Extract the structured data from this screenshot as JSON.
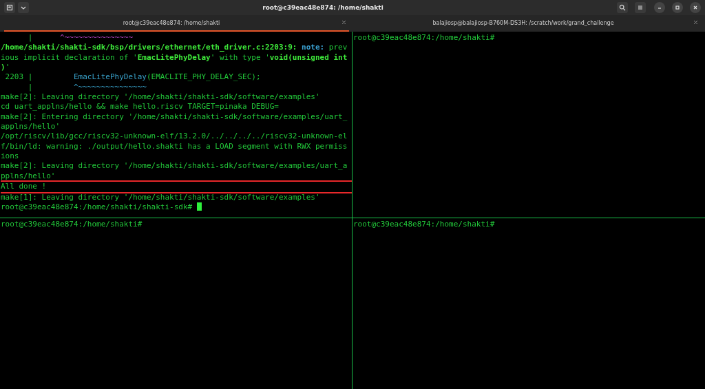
{
  "window": {
    "title": "root@c39eac48e874: /home/shakti"
  },
  "tabs": [
    {
      "label": "root@c39eac48e874: /home/shakti",
      "selected": true
    },
    {
      "label": "balajiosp@balajiosp-B760M-DS3H: /scratch/work/grand_challenge",
      "selected": false
    }
  ],
  "panes": [
    {
      "cursor": true,
      "lines": [
        {
          "highlighted": false,
          "segments": [
            {
              "text": "      |      ",
              "kind": "plain"
            },
            {
              "text": "^~~~~~~~~~~~~~~~",
              "kind": "caret"
            }
          ]
        },
        {
          "highlighted": false,
          "segments": [
            {
              "text": "/home/shakti/shakti-sdk/bsp/drivers/ethernet/eth_driver.c:2203:9: ",
              "kind": "bold"
            },
            {
              "text": "note:",
              "kind": "note"
            },
            {
              "text": " prev",
              "kind": "plain"
            }
          ]
        },
        {
          "highlighted": false,
          "segments": [
            {
              "text": "ious implicit declaration of '",
              "kind": "plain"
            },
            {
              "text": "EmacLitePhyDelay",
              "kind": "bold"
            },
            {
              "text": "' with type '",
              "kind": "plain"
            },
            {
              "text": "void(unsigned int",
              "kind": "bold"
            }
          ]
        },
        {
          "highlighted": false,
          "segments": [
            {
              "text": ")",
              "kind": "bold"
            },
            {
              "text": "'",
              "kind": "plain"
            }
          ]
        },
        {
          "highlighted": false,
          "segments": [
            {
              "text": " 2203 |         ",
              "kind": "plain"
            },
            {
              "text": "EmacLitePhyDelay",
              "kind": "function"
            },
            {
              "text": "(EMACLITE_PHY_DELAY_SEC);",
              "kind": "plain"
            }
          ]
        },
        {
          "highlighted": false,
          "segments": [
            {
              "text": "      |         ",
              "kind": "plain"
            },
            {
              "text": "^~~~~~~~~~~~~~~~",
              "kind": "function"
            }
          ]
        },
        {
          "highlighted": false,
          "segments": [
            {
              "text": "make[2]: Leaving directory '/home/shakti/shakti-sdk/software/examples'",
              "kind": "plain"
            }
          ]
        },
        {
          "highlighted": false,
          "segments": [
            {
              "text": "cd uart_applns/hello && make hello.riscv TARGET=pinaka DEBUG=",
              "kind": "plain"
            }
          ]
        },
        {
          "highlighted": false,
          "segments": [
            {
              "text": "make[2]: Entering directory '/home/shakti/shakti-sdk/software/examples/uart_",
              "kind": "plain"
            }
          ]
        },
        {
          "highlighted": false,
          "segments": [
            {
              "text": "applns/hello'",
              "kind": "plain"
            }
          ]
        },
        {
          "highlighted": false,
          "segments": [
            {
              "text": "/opt/riscv/lib/gcc/riscv32-unknown-elf/13.2.0/../../../../riscv32-unknown-el",
              "kind": "plain"
            }
          ]
        },
        {
          "highlighted": false,
          "segments": [
            {
              "text": "f/bin/ld: warning: ./output/hello.shakti has a LOAD segment with RWX permiss",
              "kind": "plain"
            }
          ]
        },
        {
          "highlighted": false,
          "segments": [
            {
              "text": "ions",
              "kind": "plain"
            }
          ]
        },
        {
          "highlighted": false,
          "segments": [
            {
              "text": "make[2]: Leaving directory '/home/shakti/shakti-sdk/software/examples/uart_a",
              "kind": "plain"
            }
          ]
        },
        {
          "highlighted": false,
          "segments": [
            {
              "text": "pplns/hello'",
              "kind": "plain"
            }
          ]
        },
        {
          "highlighted": true,
          "segments": [
            {
              "text": "All done !",
              "kind": "plain"
            }
          ]
        },
        {
          "highlighted": false,
          "segments": [
            {
              "text": "make[1]: Leaving directory '/home/shakti/shakti-sdk/software/examples'",
              "kind": "plain"
            }
          ]
        },
        {
          "highlighted": false,
          "segments": [
            {
              "text": "root@c39eac48e874:/home/shakti/shakti-sdk# ",
              "kind": "plain"
            }
          ]
        }
      ]
    },
    {
      "cursor": false,
      "lines": [
        {
          "highlighted": false,
          "segments": [
            {
              "text": "root@c39eac48e874:/home/shakti#",
              "kind": "plain"
            }
          ]
        }
      ]
    },
    {
      "cursor": false,
      "lines": [
        {
          "highlighted": false,
          "segments": [
            {
              "text": "root@c39eac48e874:/home/shakti#",
              "kind": "plain"
            }
          ]
        }
      ]
    },
    {
      "cursor": false,
      "lines": [
        {
          "highlighted": false,
          "segments": [
            {
              "text": "root@c39eac48e874:/home/shakti#",
              "kind": "plain"
            }
          ]
        }
      ]
    }
  ]
}
